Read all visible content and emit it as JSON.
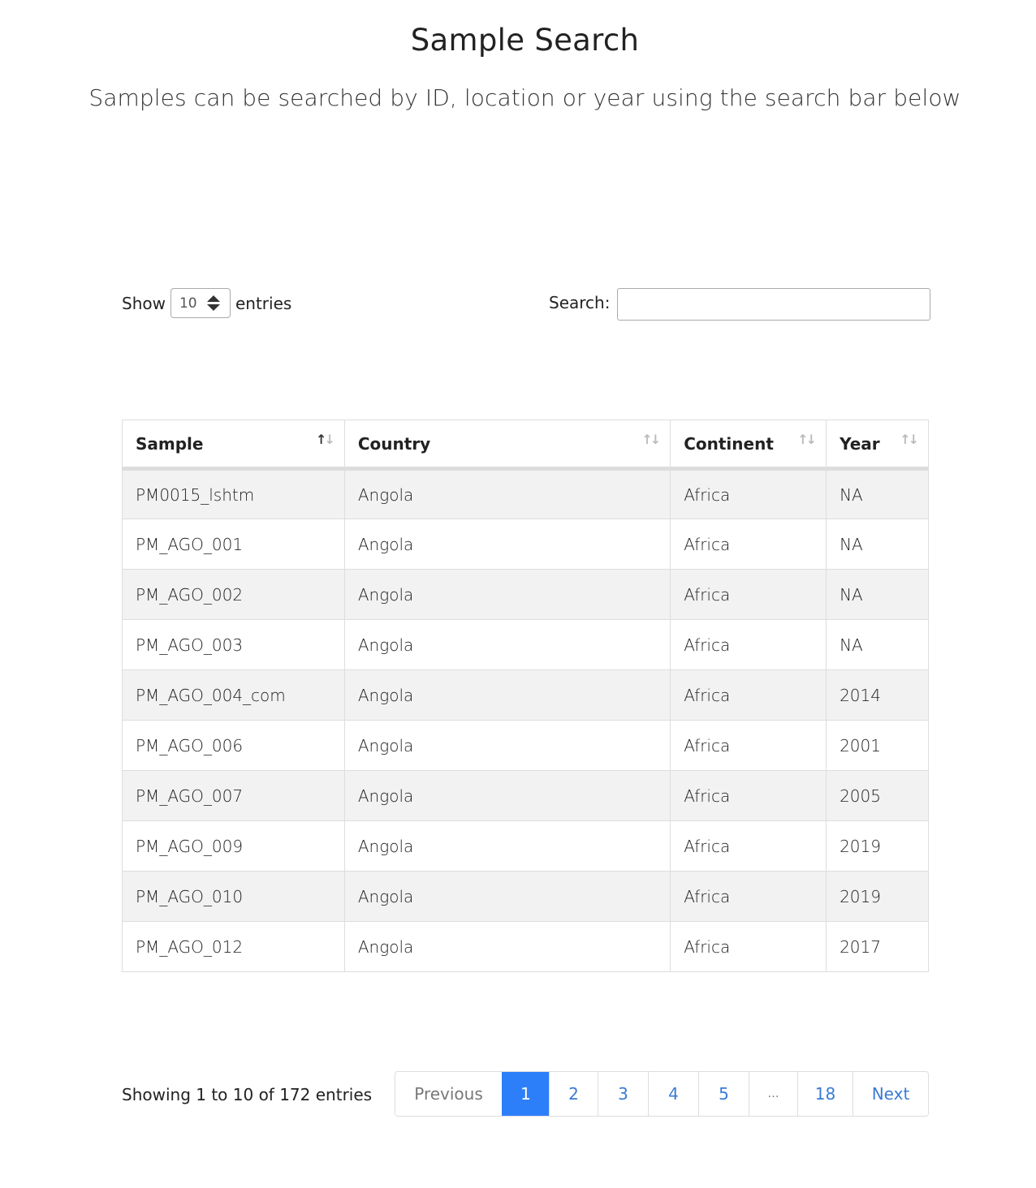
{
  "page": {
    "title": "Sample Search",
    "subtitle": "Samples can be searched by ID, location or year using the search bar below"
  },
  "length_control": {
    "prefix": "Show",
    "value": "10",
    "suffix": "entries"
  },
  "search": {
    "label": "Search:",
    "value": ""
  },
  "table": {
    "columns": [
      "Sample",
      "Country",
      "Continent",
      "Year"
    ],
    "sorted_column": "Sample",
    "rows": [
      [
        "PM0015_lshtm",
        "Angola",
        "Africa",
        "NA"
      ],
      [
        "PM_AGO_001",
        "Angola",
        "Africa",
        "NA"
      ],
      [
        "PM_AGO_002",
        "Angola",
        "Africa",
        "NA"
      ],
      [
        "PM_AGO_003",
        "Angola",
        "Africa",
        "NA"
      ],
      [
        "PM_AGO_004_com",
        "Angola",
        "Africa",
        "2014"
      ],
      [
        "PM_AGO_006",
        "Angola",
        "Africa",
        "2001"
      ],
      [
        "PM_AGO_007",
        "Angola",
        "Africa",
        "2005"
      ],
      [
        "PM_AGO_009",
        "Angola",
        "Africa",
        "2019"
      ],
      [
        "PM_AGO_010",
        "Angola",
        "Africa",
        "2019"
      ],
      [
        "PM_AGO_012",
        "Angola",
        "Africa",
        "2017"
      ]
    ]
  },
  "info": {
    "text": "Showing 1 to 10 of 172 entries"
  },
  "pagination": {
    "previous": "Previous",
    "pages": [
      "1",
      "2",
      "3",
      "4",
      "5",
      "…",
      "18"
    ],
    "active": "1",
    "next": "Next"
  },
  "colors": {
    "accent": "#2d7ff9",
    "link": "#3a7bd5",
    "stripe": "#f2f2f2",
    "border": "#dddddd"
  }
}
